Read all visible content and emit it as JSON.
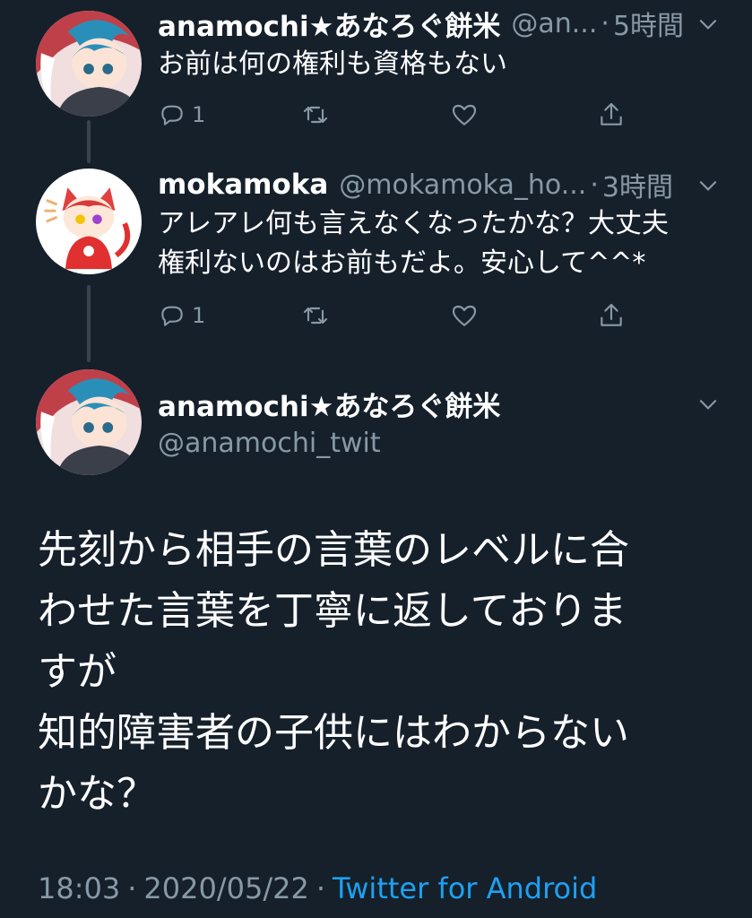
{
  "tweets": [
    {
      "name": "anamochi★あなろぐ餅米",
      "handle": "@an...",
      "time": "5時間",
      "text": "お前は何の権利も資格もない",
      "reply_count": "1"
    },
    {
      "name": "mokamoka",
      "handle": "@mokamoka_ho...",
      "time": "3時間",
      "text_lines": [
        "アレアレ何も言えなくなったかな？大丈夫",
        "権利ないのはお前もだよ。安心して^^*"
      ],
      "reply_count": "1"
    }
  ],
  "main_tweet": {
    "name": "anamochi★あなろぐ餅米",
    "handle": "@anamochi_twit",
    "text_lines": [
      "先刻から相手の言葉のレベルに合",
      "わせた言葉を丁寧に返しておりま",
      "すが",
      "知的障害者の子供にはわからない",
      "かな？"
    ],
    "time": "18:03",
    "date": "2020/05/22",
    "separator": "·",
    "client": "Twitter for Android"
  },
  "icons": [
    "reply-icon",
    "retweet-icon",
    "like-icon",
    "share-icon",
    "chevron-down-icon"
  ],
  "colors": {
    "background": "#15202b",
    "secondary_text": "#8899a6",
    "link": "#1da1f2",
    "thread_line": "#38444d"
  }
}
